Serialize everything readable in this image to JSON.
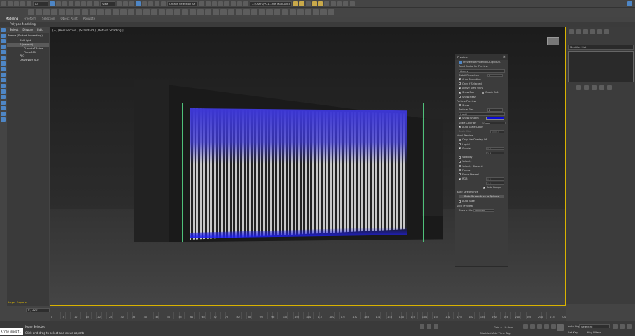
{
  "app": {
    "title": "C:\\Users\\PC1...3ds Max 2024",
    "workspace": "Modeling",
    "selection_set": "Create Selection Se",
    "view_dropdown": "View",
    "all_dropdown": "All"
  },
  "ribbon": {
    "tabs": [
      "Modeling",
      "Freeform",
      "Selection",
      "Object Paint",
      "Populate"
    ],
    "active_tab_label": "Polygon Modeling"
  },
  "explorer": {
    "menu": [
      "Select",
      "Display",
      "Edit"
    ],
    "header": "Name (Sorted Ascending)",
    "items": [
      "Abl Light",
      "0 (default)",
      "PhoenixFDLiqu",
      "Plane001",
      "PFO",
      "DRIVEWAY ALU"
    ],
    "footer": "Layer Explorer"
  },
  "viewport": {
    "label": "[+] [Perspective ] [Standard ] [Default Shading ]",
    "fluid_color": "#3c37d4",
    "bbox_color": "#4fc07a",
    "frame_color": "#d9b300"
  },
  "preview": {
    "title": "Preview",
    "preview_of": "Preview of PhoenixFDLiquid001",
    "read_cache_label": "Read Cache for Preview:",
    "read_cache_value": "Always",
    "detail_reduction_label": "Detail Reduction",
    "detail_reduction_value": "0",
    "auto_reduction": "Auto Reduction",
    "only_if_selected": "Only If Selected",
    "active_view_only": "Active View Only",
    "show_box": "Show Box",
    "graph_cells": "Graph Cells",
    "show_mesh": "Show Mesh",
    "particle_preview": "Particle Preview",
    "show": "Show",
    "particle_size_label": "Particle Size",
    "particle_size_value": "2",
    "particle_type": "Liquid",
    "show_system": "Show System",
    "show_system_color": "#0a0ad8",
    "scale_color_by_label": "Scale Color By",
    "scale_color_by_value": "Speed",
    "auto_scale_color": "Auto Scale Color",
    "scale_max_label": "Scale Max",
    "scale_max_value": "1000.0",
    "voxel_preview": "Voxel Preview",
    "only_overlap": "Only the Overlap Of:",
    "liquid": "Liquid",
    "special": "Special",
    "special_v1": "0.0",
    "special_v2": "1.0",
    "vorticity": "Vorticity",
    "velocity": "Velocity",
    "velocity_streamlines": "Velocity Streaml.",
    "forces": "Forces",
    "force_streamlines": "Force Streaml.",
    "rgb": "RGB",
    "rgb_v1": "0.0",
    "rgb_v2": "1.0",
    "auto_range": "Auto Range",
    "bake_streamlines": "Bake Streamlines",
    "bake_button": "Bake Streamlines to Splines",
    "auto_bake": "Auto Bake",
    "slice_preview": "Slice Preview",
    "draw_slice_label": "Draw a Slice",
    "draw_slice_value": "Disabled"
  },
  "command_panel": {
    "modifier_list": "Modifier List"
  },
  "timeline": {
    "frame_counter": "0 / 220",
    "ticks": [
      "0",
      "5",
      "10",
      "15",
      "20",
      "25",
      "30",
      "35",
      "40",
      "45",
      "50",
      "55",
      "60",
      "65",
      "70",
      "75",
      "80",
      "85",
      "90",
      "95",
      "100",
      "105",
      "110",
      "115",
      "120",
      "125",
      "130",
      "135",
      "140",
      "145",
      "150",
      "155",
      "160",
      "165",
      "170",
      "175",
      "180",
      "185",
      "190",
      "195",
      "200",
      "205",
      "210",
      "215",
      "220"
    ]
  },
  "status": {
    "script_text": "Array modifi",
    "none_selected": "None Selected",
    "hint": "Click and drag to select and move objects",
    "grid": "Grid = 10.0cm",
    "disabled": "Disabled",
    "add_time_tag": "Add Time Tag",
    "auto_key": "Auto Key",
    "set_key": "Set Key",
    "selected": "Selected",
    "key_filters": "Key Filters..."
  }
}
